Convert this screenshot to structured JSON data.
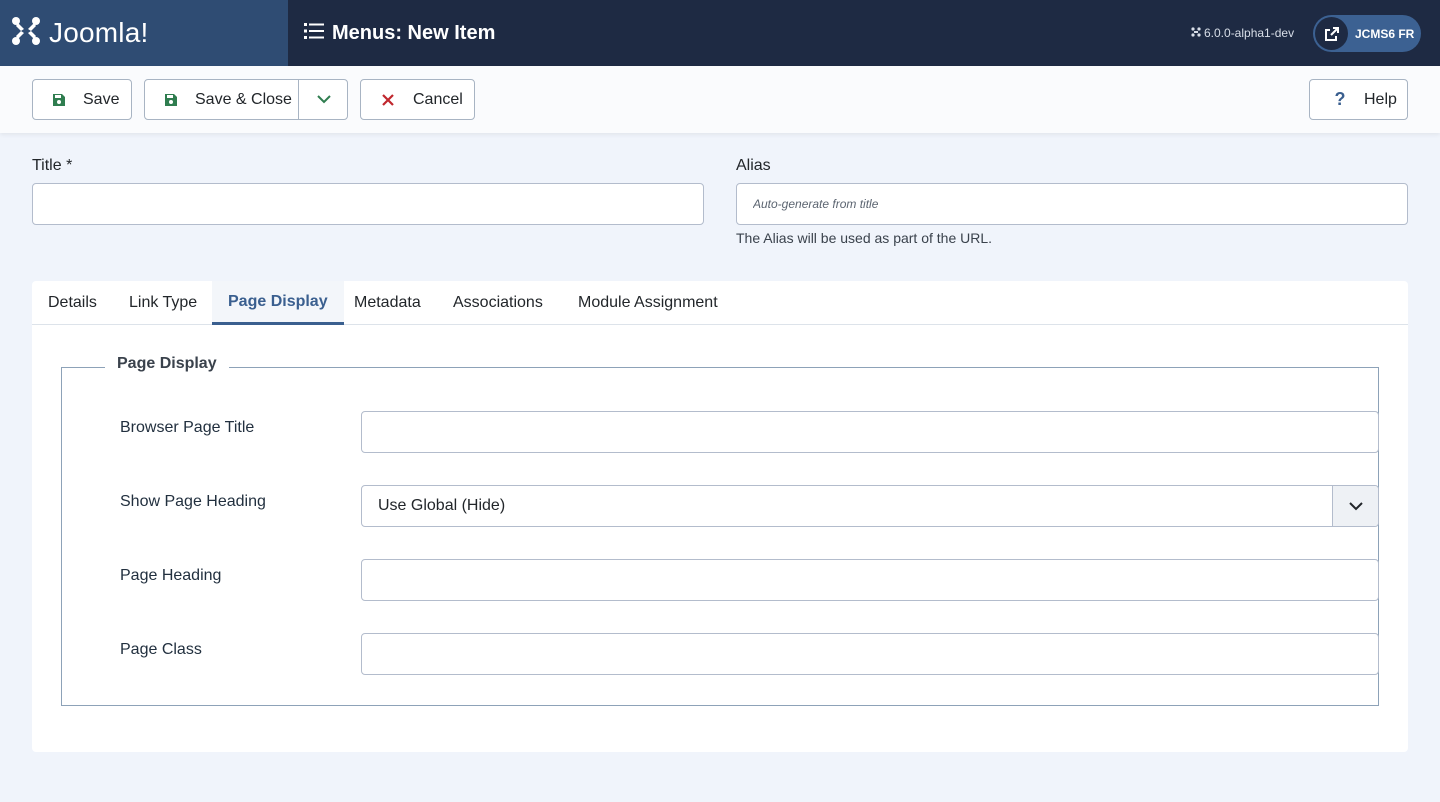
{
  "header": {
    "brand_name": "Joomla!",
    "page_title": "Menus: New Item",
    "version": "6.0.0-alpha1-dev",
    "site_button_label": "JCMS6 FR",
    "icons": {
      "brand": "joomla-logo-icon",
      "title": "list-icon",
      "version": "joomla-small-icon",
      "site": "external-link-icon"
    }
  },
  "toolbar": {
    "save_label": "Save",
    "save_close_label": "Save & Close",
    "cancel_label": "Cancel",
    "help_label": "Help",
    "icons": {
      "save": "floppy-disk-icon",
      "save_close": "floppy-disk-icon",
      "dropdown": "chevron-down-icon",
      "cancel": "times-icon",
      "help": "question-icon"
    }
  },
  "form": {
    "title_label": "Title *",
    "title_value": "",
    "alias_label": "Alias",
    "alias_value": "",
    "alias_placeholder": "Auto-generate from title",
    "alias_help": "The Alias will be used as part of the URL."
  },
  "tabs": [
    {
      "label": "Details",
      "active": false
    },
    {
      "label": "Link Type",
      "active": false
    },
    {
      "label": "Page Display",
      "active": true
    },
    {
      "label": "Metadata",
      "active": false
    },
    {
      "label": "Associations",
      "active": false
    },
    {
      "label": "Module Assignment",
      "active": false
    }
  ],
  "page_display": {
    "legend": "Page Display",
    "fields": [
      {
        "label": "Browser Page Title",
        "type": "text",
        "value": ""
      },
      {
        "label": "Show Page Heading",
        "type": "select",
        "value": "Use Global (Hide)"
      },
      {
        "label": "Page Heading",
        "type": "text",
        "value": ""
      },
      {
        "label": "Page Class",
        "type": "text",
        "value": ""
      }
    ]
  },
  "colors": {
    "header_bg": "#1e2a43",
    "brand_bg": "#2f4c73",
    "save_icon": "#2f7d4f",
    "cancel_icon": "#c0272d",
    "help_icon": "#3a5f8f",
    "active_tab": "#3a5f8f",
    "page_bg": "#f0f4fb"
  }
}
